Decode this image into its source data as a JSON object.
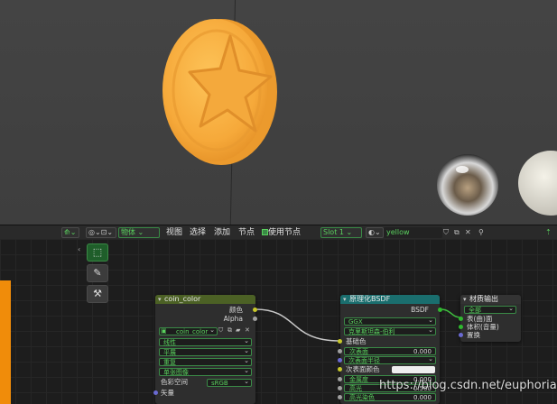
{
  "header": {
    "object_menu": "物体",
    "menus": [
      "视图",
      "选择",
      "添加",
      "节点"
    ],
    "use_nodes_label": "使用节点",
    "slot": "Slot 1",
    "material_name": "yellow"
  },
  "nodes": {
    "image": {
      "title": "coin_color",
      "outputs": [
        "颜色",
        "Alpha"
      ],
      "image_name": "coin_color",
      "interpolation": "线性",
      "projection": "平展",
      "extension": "重复",
      "source": "单张图像",
      "colorspace_label": "色彩空间",
      "colorspace_value": "sRGB",
      "vector_label": "矢量"
    },
    "bsdf": {
      "title": "原理化BSDF",
      "output": "BSDF",
      "distribution": "GGX",
      "subsurface_method": "克里斯坦森-伯利",
      "base_color_label": "基础色",
      "subsurface_label": "次表面",
      "subsurface_value": "0.000",
      "subsurface_radius_label": "次表面半径",
      "subsurface_color_label": "次表面颜色",
      "metallic_label": "金属度",
      "metallic_value": "0.000",
      "specular_label": "高光",
      "specular_value": "0.500",
      "specular_tint_label": "高光染色",
      "specular_tint_value": "0.000"
    },
    "output": {
      "title": "材质输出",
      "target": "全部",
      "inputs": [
        "表(曲)面",
        "体积(音量)",
        "置换"
      ]
    }
  },
  "watermark": "https://blog.csdn.net/euphorias",
  "colors": {
    "image_header": "#4c6125",
    "bsdf_header": "#1a6e6e",
    "output_header": "#333333",
    "coin": "#f7b23c",
    "accent_green": "#3a8a46"
  }
}
